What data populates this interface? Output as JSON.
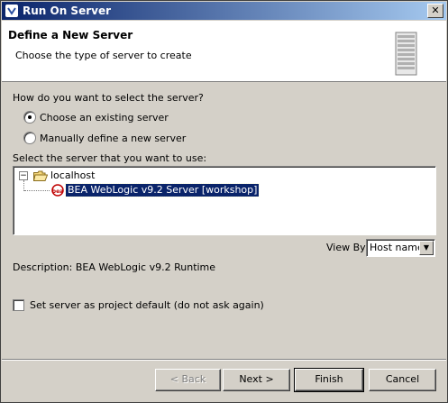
{
  "window": {
    "title": "Run On Server",
    "close_glyph": "✕"
  },
  "header": {
    "title": "Define a New Server",
    "description": "Choose the type of server to create",
    "graphic": "server-tower-icon"
  },
  "selection": {
    "question": "How do you want to select the server?",
    "options": [
      {
        "label": "Choose an existing server",
        "checked": true
      },
      {
        "label": "Manually define a new server",
        "checked": false
      }
    ],
    "list_label": "Select the server that you want to use:"
  },
  "tree": {
    "expander": "−",
    "host": "localhost",
    "server": "BEA WebLogic v9.2 Server [workshop]",
    "server_icon_text": "bea"
  },
  "view_by": {
    "label": "View By:",
    "value": "Host name",
    "arrow": "▼"
  },
  "description": "Description: BEA WebLogic v9.2 Runtime",
  "default_checkbox": {
    "label": "Set server as project default (do not ask again)",
    "checked": false
  },
  "buttons": {
    "back": "< Back",
    "next": "Next >",
    "finish": "Finish",
    "cancel": "Cancel"
  }
}
